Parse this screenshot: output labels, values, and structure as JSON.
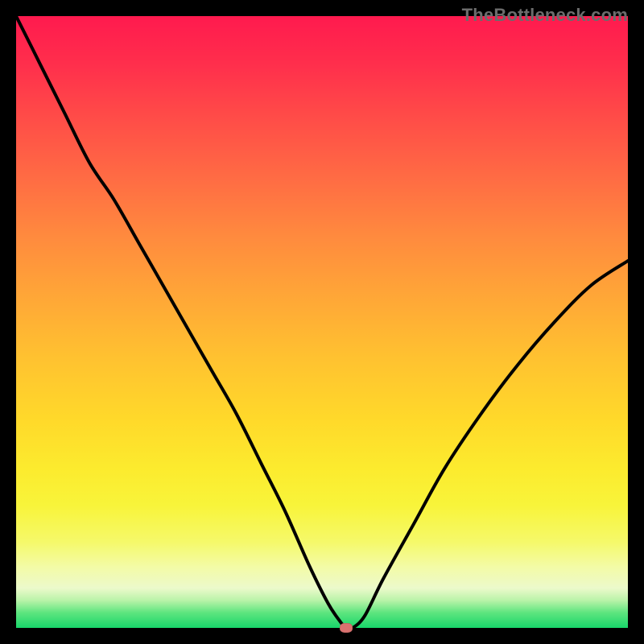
{
  "watermark": "TheBottleneck.com",
  "colors": {
    "frame_border": "#000000",
    "marker": "#d9716f",
    "curve": "#000000",
    "gradient_top": "#ff1a4e",
    "gradient_bottom": "#18d66a"
  },
  "chart_data": {
    "type": "line",
    "title": "",
    "xlabel": "",
    "ylabel": "",
    "xlim": [
      0,
      100
    ],
    "ylim": [
      0,
      100
    ],
    "grid": false,
    "legend": false,
    "background": "vertical gradient: green (bottom) → pale yellow → yellow → orange → red/pink (top)",
    "note": "No axis ticks or numeric labels are rendered. x/y values are read off as percentage of plot width/height, origin at bottom-left. Curve descends from top-left, reaches a minimum near x≈54, then rises to the right edge.",
    "series": [
      {
        "name": "bottleneck-curve",
        "x": [
          0,
          4,
          8,
          12,
          16,
          20,
          24,
          28,
          32,
          36,
          40,
          44,
          48,
          51,
          53,
          54,
          55,
          57,
          60,
          65,
          70,
          76,
          82,
          88,
          94,
          100
        ],
        "y": [
          100,
          92,
          84,
          76,
          70,
          63,
          56,
          49,
          42,
          35,
          27,
          19,
          10,
          4,
          1,
          0,
          0,
          2,
          8,
          17,
          26,
          35,
          43,
          50,
          56,
          60
        ]
      }
    ],
    "annotations": [
      {
        "name": "minimum-marker",
        "kind": "point",
        "x": 54,
        "y": 0,
        "color": "#d9716f"
      }
    ]
  }
}
